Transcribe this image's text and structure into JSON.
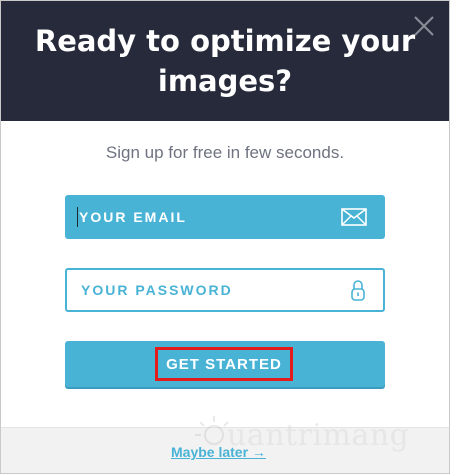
{
  "modal": {
    "title": "Ready to optimize your images?",
    "subtitle": "Sign up for free in few seconds."
  },
  "form": {
    "email_placeholder": "YOUR EMAIL",
    "email_value": "",
    "password_placeholder": "YOUR PASSWORD",
    "password_value": "",
    "submit_label": "GET STARTED"
  },
  "footer": {
    "later_label": "Maybe later →"
  },
  "watermark": {
    "text": "uantrimang"
  },
  "icons": {
    "close": "close-icon",
    "email": "envelope-icon",
    "password": "lock-icon"
  },
  "colors": {
    "header_bg": "#262a3a",
    "accent": "#49b3d6",
    "highlight": "#e31b1b",
    "subtitle": "#6f7380"
  }
}
